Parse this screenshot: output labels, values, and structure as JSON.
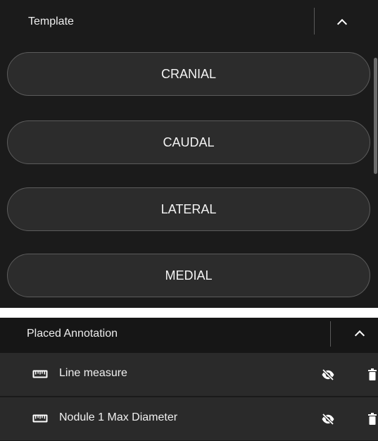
{
  "template_panel": {
    "title": "Template",
    "collapse_icon": "chevron-up-icon",
    "buttons": [
      {
        "label": "CRANIAL"
      },
      {
        "label": "CAUDAL"
      },
      {
        "label": "LATERAL"
      },
      {
        "label": "MEDIAL"
      }
    ]
  },
  "annotation_panel": {
    "title": "Placed Annotation",
    "collapse_icon": "chevron-up-icon",
    "items": [
      {
        "label": "Line measure",
        "icon": "ruler-icon",
        "visibility_icon": "eye-slash-icon",
        "delete_icon": "trash-icon"
      },
      {
        "label": "Nodule 1 Max Diameter",
        "icon": "ruler-icon",
        "visibility_icon": "eye-slash-icon",
        "delete_icon": "trash-icon"
      }
    ]
  },
  "colors": {
    "panel_background": "#1b1b1b",
    "button_background": "#2c2c2c",
    "button_border": "#5c5c5c",
    "row_background": "#2a2a2a",
    "text": "#f0f0f0"
  }
}
